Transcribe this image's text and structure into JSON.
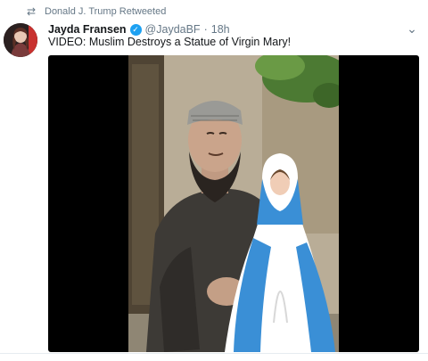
{
  "retweet": {
    "icon": "retweet-icon",
    "text": "Donald J. Trump Retweeted"
  },
  "tweet": {
    "author": {
      "display_name": "Jayda Fransen",
      "verified_icon": "verified-badge-icon",
      "handle": "@JaydaBF",
      "separator": "·",
      "time": "18h"
    },
    "menu_icon": "chevron-down-icon",
    "text": "VIDEO: Muslim Destroys a Statue of Virgin Mary!",
    "media": {
      "type": "video",
      "scene": "man-with-statue-of-virgin-mary"
    }
  },
  "colors": {
    "accent": "#1da1f2",
    "secondary_text": "#657786",
    "media_background": "#000000"
  }
}
